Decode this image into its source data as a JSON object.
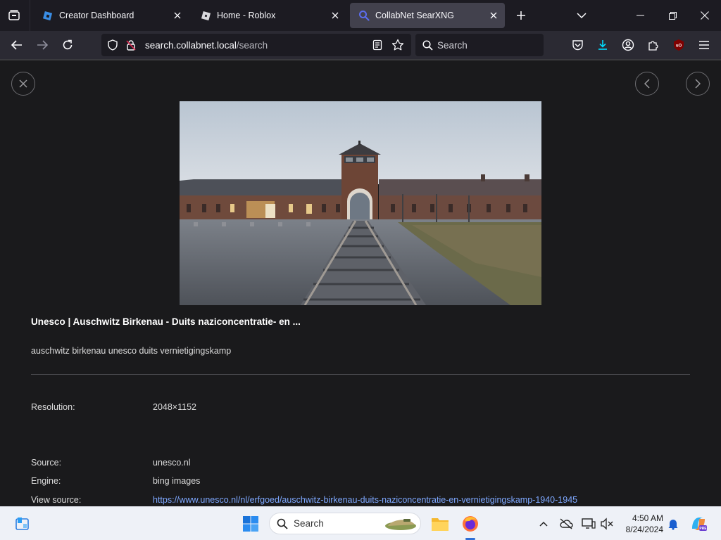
{
  "browser": {
    "tabs": [
      {
        "title": "Creator Dashboard",
        "active": false
      },
      {
        "title": "Home - Roblox",
        "active": false
      },
      {
        "title": "CollabNet SearXNG",
        "active": true
      }
    ],
    "url": {
      "host": "search.collabnet.local",
      "path": "/search"
    },
    "search_placeholder": "Search"
  },
  "result": {
    "title": "Unesco | Auschwitz Birkenau - Duits naziconcentratie- en ...",
    "description": "auschwitz birkenau unesco duits vernietigingskamp",
    "details": {
      "resolution_label": "Resolution:",
      "resolution_value": "2048×1152",
      "source_label": "Source:",
      "source_value": "unesco.nl",
      "engine_label": "Engine:",
      "engine_value": "bing images",
      "view_source_label": "View source:",
      "view_source_value": "https://www.unesco.nl/nl/erfgoed/auschwitz-birkenau-duits-naziconcentratie-en-vernietigingskamp-1940-1945"
    }
  },
  "taskbar": {
    "search_placeholder": "Search",
    "time": "4:50 AM",
    "date": "8/24/2024"
  },
  "colors": {
    "accent": "#2f6fd6",
    "link": "#7ea8ff",
    "content_bg": "#1a1a1c"
  }
}
